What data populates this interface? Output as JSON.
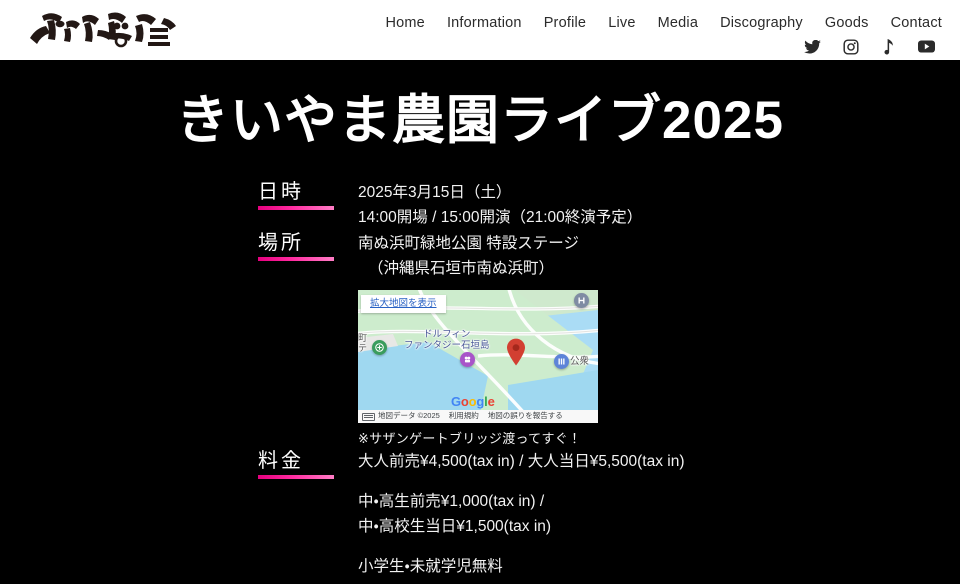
{
  "header": {
    "logo_alt": "きいやま商店",
    "nav": [
      {
        "label": "Home"
      },
      {
        "label": "Information"
      },
      {
        "label": "Profile"
      },
      {
        "label": "Live"
      },
      {
        "label": "Media"
      },
      {
        "label": "Discography"
      },
      {
        "label": "Goods"
      },
      {
        "label": "Contact"
      }
    ],
    "socials": [
      {
        "name": "twitter-icon"
      },
      {
        "name": "instagram-icon"
      },
      {
        "name": "music-note-icon"
      },
      {
        "name": "youtube-icon"
      }
    ]
  },
  "main": {
    "title": "きいやま農園ライブ2025",
    "rows": {
      "datetime": {
        "label": "日時",
        "line1": "2025年3月15日（土）",
        "line2": "14:00開場 / 15:00開演（21:00終演予定）"
      },
      "place": {
        "label": "場所",
        "line1": "南ぬ浜町緑地公園 特設ステージ",
        "line2": "（沖縄県石垣市南ぬ浜町）",
        "note": "※サザンゲートブリッジ渡ってすぐ！"
      },
      "fee": {
        "label": "料金",
        "line1": "大人前売¥4,500(tax in) / 大人当日¥5,500(tax in)",
        "line2": "中・高生前売¥1,000(tax in) /",
        "line3": "中・高校生当日¥1,500(tax in)",
        "line4": "小学生・未就学児無料"
      }
    }
  },
  "map": {
    "expand_link": "拡大地図を表示",
    "poi_dolphin_line1": "ドルフィン",
    "poi_dolphin_line2": "ファンタジー石垣島",
    "poi_machi": "町\nテ",
    "poi_koshu": "公衆",
    "watermark": "Google",
    "attribution_data": "地図データ ©2025",
    "attribution_terms": "利用規約",
    "attribution_report": "地図の誤りを報告する"
  },
  "colors": {
    "accent_pink": "#e6007e",
    "accent_pink_light": "#ff7ec6",
    "background": "#000000",
    "header_bg": "#ffffff",
    "text": "#ffffff"
  }
}
